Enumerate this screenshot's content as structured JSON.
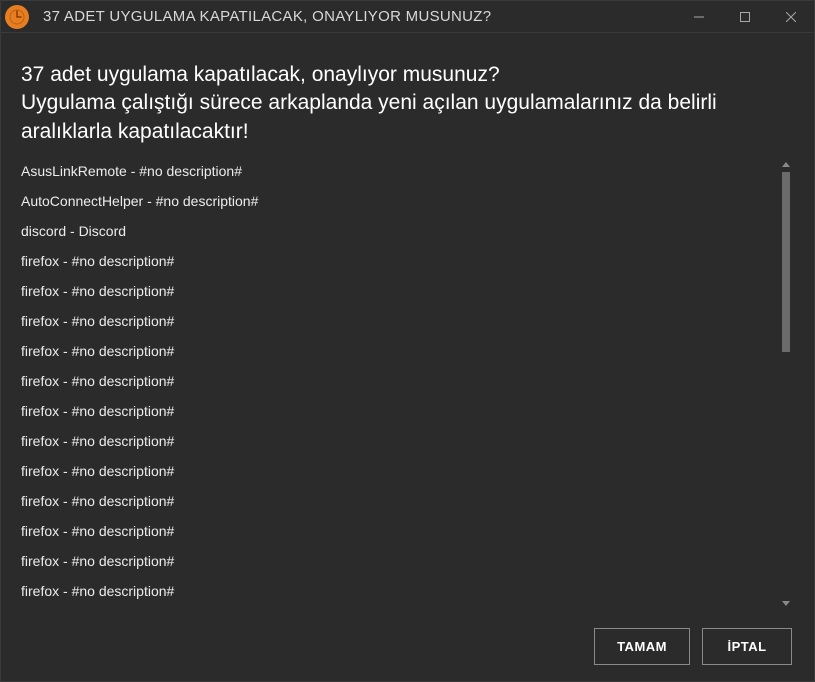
{
  "titlebar": {
    "title": "37 ADET UYGULAMA KAPATILACAK, ONAYLIYOR MUSUNUZ?"
  },
  "heading": {
    "line1": "37 adet uygulama kapatılacak, onaylıyor musunuz?",
    "line2": "Uygulama çalıştığı sürece arkaplanda yeni açılan uygulamalarınız da belirli aralıklarla kapatılacaktır!"
  },
  "items": [
    "AsusLinkRemote - #no description#",
    "AutoConnectHelper - #no description#",
    "discord - Discord",
    "firefox - #no description#",
    "firefox - #no description#",
    "firefox - #no description#",
    "firefox - #no description#",
    "firefox - #no description#",
    "firefox - #no description#",
    "firefox - #no description#",
    "firefox - #no description#",
    "firefox - #no description#",
    "firefox - #no description#",
    "firefox - #no description#",
    "firefox - #no description#"
  ],
  "buttons": {
    "ok": "TAMAM",
    "cancel": "İPTAL"
  }
}
